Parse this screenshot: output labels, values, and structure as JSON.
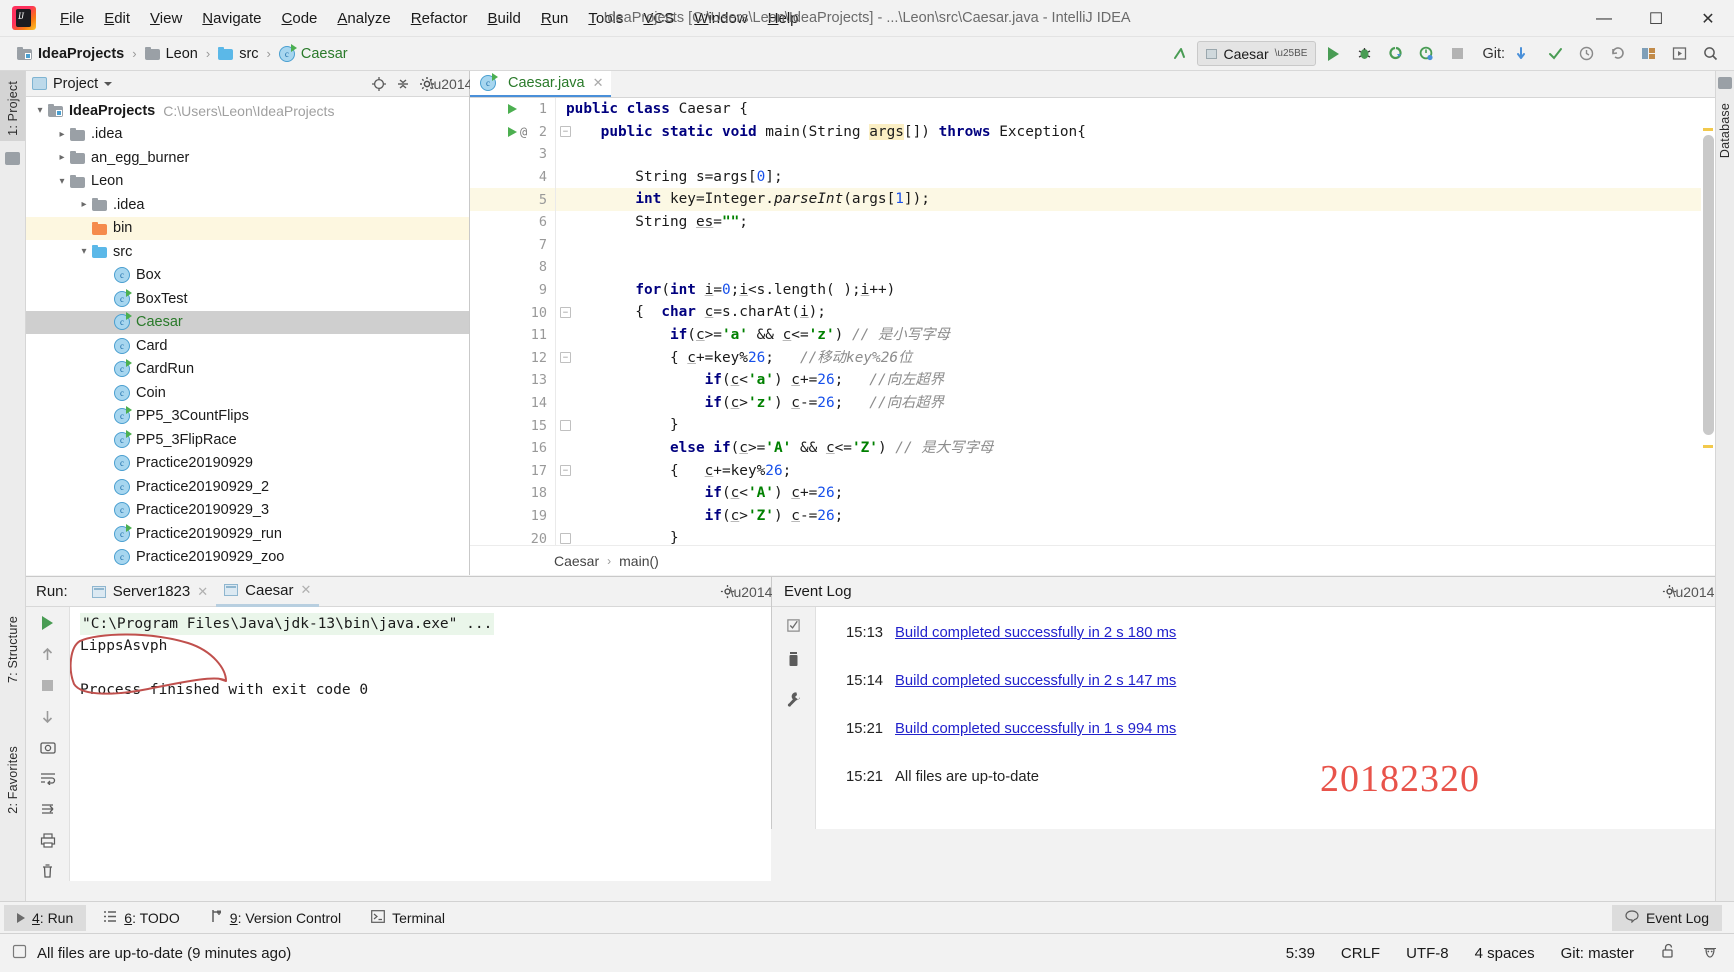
{
  "titlebar": {
    "menus": [
      {
        "first": "F",
        "rest": "ile"
      },
      {
        "first": "E",
        "rest": "dit"
      },
      {
        "first": "V",
        "rest": "iew"
      },
      {
        "first": "N",
        "rest": "avigate"
      },
      {
        "first": "C",
        "rest": "ode"
      },
      {
        "first": "A",
        "rest": "nalyze"
      },
      {
        "first": "R",
        "rest": "efactor"
      },
      {
        "first": "B",
        "rest": "uild"
      },
      {
        "first": "R",
        "rest": "un"
      },
      {
        "first": "T",
        "rest": "ools"
      },
      {
        "first": "V",
        "rest": "CS"
      },
      {
        "first": "W",
        "rest": "indow"
      },
      {
        "first": "H",
        "rest": "elp"
      }
    ],
    "window_title": "IdeaProjects [C:\\Users\\Leon\\IdeaProjects] - ...\\Leon\\src\\Caesar.java - IntelliJ IDEA",
    "minimize": "—",
    "maximize": "☐",
    "close": "✕"
  },
  "navbar": {
    "breadcrumbs": [
      {
        "label": "IdeaProjects",
        "icon": "project-folder-icon",
        "style": "bold"
      },
      {
        "label": "Leon",
        "icon": "folder-grey-icon",
        "style": "normal"
      },
      {
        "label": "src",
        "icon": "folder-blue-icon",
        "style": "normal"
      },
      {
        "label": "Caesar",
        "icon": "java-class-runnable-icon",
        "style": "green"
      }
    ],
    "separator": "›",
    "run_config": "Caesar",
    "git_label": "Git:",
    "buttons": {
      "back": "↖",
      "run": "run-button",
      "debug": "debug-button",
      "run_coverage": "run-with-coverage-button",
      "profile": "profiler-button",
      "stop": "stop-button",
      "update_project": "update-project-button",
      "commit": "commit-button",
      "history": "history-button",
      "rollback": "rollback-button",
      "settings": "settings-button",
      "layout": "layout-button",
      "search": "search-button"
    }
  },
  "left_stripe": {
    "project_label": "1: Project",
    "structure_label": "7: Structure",
    "favorites_label": "2: Favorites"
  },
  "right_stripe": {
    "database_label": "Database"
  },
  "project_panel": {
    "title": "Project",
    "header_icons": [
      "locate-icon",
      "collapse-all-icon",
      "settings-gear-icon",
      "hide-icon"
    ],
    "tree": [
      {
        "indent": 0,
        "arrow": "∨",
        "icon": "project-folder-icon",
        "label": "IdeaProjects",
        "style": "bold",
        "path": "C:\\Users\\Leon\\IdeaProjects",
        "state": "normal"
      },
      {
        "indent": 1,
        "arrow": "›",
        "icon": "folder-grey-icon",
        "label": ".idea",
        "style": "normal",
        "path": "",
        "state": "normal"
      },
      {
        "indent": 1,
        "arrow": "›",
        "icon": "folder-grey-icon",
        "label": "an_egg_burner",
        "style": "normal",
        "path": "",
        "state": "normal"
      },
      {
        "indent": 1,
        "arrow": "∨",
        "icon": "folder-grey-icon",
        "label": "Leon",
        "style": "normal",
        "path": "",
        "state": "normal"
      },
      {
        "indent": 2,
        "arrow": "›",
        "icon": "folder-grey-icon",
        "label": ".idea",
        "style": "normal",
        "path": "",
        "state": "normal"
      },
      {
        "indent": 2,
        "arrow": "",
        "icon": "folder-orange-icon",
        "label": "bin",
        "style": "normal",
        "path": "",
        "state": "highlight"
      },
      {
        "indent": 2,
        "arrow": "∨",
        "icon": "folder-blue-icon",
        "label": "src",
        "style": "normal",
        "path": "",
        "state": "normal"
      },
      {
        "indent": 3,
        "arrow": "",
        "icon": "java-class-icon",
        "label": "Box",
        "style": "normal",
        "path": "",
        "state": "normal"
      },
      {
        "indent": 3,
        "arrow": "",
        "icon": "java-class-runnable-icon",
        "label": "BoxTest",
        "style": "normal",
        "path": "",
        "state": "normal"
      },
      {
        "indent": 3,
        "arrow": "",
        "icon": "java-class-runnable-icon",
        "label": "Caesar",
        "style": "green",
        "path": "",
        "state": "selected"
      },
      {
        "indent": 3,
        "arrow": "",
        "icon": "java-class-icon",
        "label": "Card",
        "style": "normal",
        "path": "",
        "state": "normal"
      },
      {
        "indent": 3,
        "arrow": "",
        "icon": "java-class-runnable-icon",
        "label": "CardRun",
        "style": "normal",
        "path": "",
        "state": "normal"
      },
      {
        "indent": 3,
        "arrow": "",
        "icon": "java-class-icon",
        "label": "Coin",
        "style": "normal",
        "path": "",
        "state": "normal"
      },
      {
        "indent": 3,
        "arrow": "",
        "icon": "java-class-runnable-icon",
        "label": "PP5_3CountFlips",
        "style": "normal",
        "path": "",
        "state": "normal"
      },
      {
        "indent": 3,
        "arrow": "",
        "icon": "java-class-runnable-icon",
        "label": "PP5_3FlipRace",
        "style": "normal",
        "path": "",
        "state": "normal"
      },
      {
        "indent": 3,
        "arrow": "",
        "icon": "java-class-icon",
        "label": "Practice20190929",
        "style": "normal",
        "path": "",
        "state": "normal"
      },
      {
        "indent": 3,
        "arrow": "",
        "icon": "java-class-icon",
        "label": "Practice20190929_2",
        "style": "normal",
        "path": "",
        "state": "normal"
      },
      {
        "indent": 3,
        "arrow": "",
        "icon": "java-class-icon",
        "label": "Practice20190929_3",
        "style": "normal",
        "path": "",
        "state": "normal"
      },
      {
        "indent": 3,
        "arrow": "",
        "icon": "java-class-runnable-icon",
        "label": "Practice20190929_run",
        "style": "normal",
        "path": "",
        "state": "normal"
      },
      {
        "indent": 3,
        "arrow": "",
        "icon": "java-class-icon",
        "label": "Practice20190929_zoo",
        "style": "normal",
        "path": "",
        "state": "normal"
      }
    ]
  },
  "editor": {
    "tab": {
      "label": "Caesar.java",
      "icon": "java-class-runnable-icon",
      "close": "✕"
    },
    "breadcrumb": [
      "Caesar",
      "main()"
    ],
    "breadcrumb_sep": "›",
    "lines": [
      {
        "n": "1",
        "gutter": "run",
        "fold": "",
        "hl": false
      },
      {
        "n": "2",
        "gutter": "run-at",
        "fold": "open",
        "hl": false
      },
      {
        "n": "3",
        "gutter": "",
        "fold": "",
        "hl": false
      },
      {
        "n": "4",
        "gutter": "",
        "fold": "",
        "hl": false
      },
      {
        "n": "5",
        "gutter": "",
        "fold": "",
        "hl": true
      },
      {
        "n": "6",
        "gutter": "",
        "fold": "",
        "hl": false
      },
      {
        "n": "7",
        "gutter": "",
        "fold": "",
        "hl": false
      },
      {
        "n": "8",
        "gutter": "",
        "fold": "",
        "hl": false
      },
      {
        "n": "9",
        "gutter": "",
        "fold": "",
        "hl": false
      },
      {
        "n": "10",
        "gutter": "",
        "fold": "open",
        "hl": false
      },
      {
        "n": "11",
        "gutter": "",
        "fold": "",
        "hl": false
      },
      {
        "n": "12",
        "gutter": "",
        "fold": "open",
        "hl": false
      },
      {
        "n": "13",
        "gutter": "",
        "fold": "",
        "hl": false
      },
      {
        "n": "14",
        "gutter": "",
        "fold": "",
        "hl": false
      },
      {
        "n": "15",
        "gutter": "",
        "fold": "close",
        "hl": false
      },
      {
        "n": "16",
        "gutter": "",
        "fold": "",
        "hl": false
      },
      {
        "n": "17",
        "gutter": "",
        "fold": "open",
        "hl": false
      },
      {
        "n": "18",
        "gutter": "",
        "fold": "",
        "hl": false
      },
      {
        "n": "19",
        "gutter": "",
        "fold": "",
        "hl": false
      },
      {
        "n": "20",
        "gutter": "",
        "fold": "close",
        "hl": false
      }
    ],
    "code_text": [
      "public class Caesar {",
      "    public static void main(String args[]) throws Exception{",
      "",
      "        String s=args[0];",
      "        int key=Integer.parseInt(args[1]);",
      "        String es=\"\";",
      "",
      "",
      "        for(int i=0;i<s.length( );i++)",
      "        {  char c=s.charAt(i);",
      "            if(c>='a' && c<='z') // 是小写字母",
      "            { c+=key%26;   //移动key%26位",
      "                if(c<'a') c+=26;   //向左超界",
      "                if(c>'z') c-=26;   //向右超界",
      "            }",
      "            else if(c>='A' && c<='Z') // 是大写字母",
      "            {   c+=key%26;",
      "                if(c<'A') c+=26;",
      "                if(c>'Z') c-=26;",
      "            }"
    ]
  },
  "run_panel": {
    "label": "Run:",
    "tabs": [
      {
        "label": "Server1823",
        "active": false,
        "close": "✕"
      },
      {
        "label": "Caesar",
        "active": true,
        "close": "✕"
      }
    ],
    "side_buttons": [
      "rerun-icon",
      "up-arrow-icon",
      "down-arrow-icon",
      "camera-icon",
      "wrap-icon",
      "print-icon",
      "scroll-icon",
      "trash-icon"
    ],
    "console": {
      "command": "\"C:\\Program Files\\Java\\jdk-13\\bin\\java.exe\" ...",
      "output": "LippsAsvph",
      "exit": "Process finished with exit code 0"
    }
  },
  "event_log": {
    "title": "Event Log",
    "side_buttons": [
      "mark-read-icon",
      "trash-icon",
      "wrench-icon"
    ],
    "entries": [
      {
        "time": "15:13",
        "text": "Build completed successfully in 2 s 180 ms",
        "link": true
      },
      {
        "time": "15:14",
        "text": "Build completed successfully in 2 s 147 ms",
        "link": true
      },
      {
        "time": "15:21",
        "text": "Build completed successfully in 1 s 994 ms",
        "link": true
      },
      {
        "time": "15:21",
        "text": "All files are up-to-date",
        "link": false
      }
    ],
    "watermark": "20182320"
  },
  "toolwindow_bar": {
    "items": [
      {
        "icon": "run-triangle-icon",
        "num": "4",
        "label": ": Run",
        "active": true
      },
      {
        "icon": "todo-list-icon",
        "num": "6",
        "label": ": TODO",
        "active": false
      },
      {
        "icon": "version-control-icon",
        "num": "9",
        "label": ": Version Control",
        "active": false
      },
      {
        "icon": "terminal-icon",
        "num": "",
        "label": "Terminal",
        "active": false
      }
    ],
    "right_item": {
      "icon": "event-log-icon",
      "label": "Event Log"
    }
  },
  "statusbar": {
    "message": "All files are up-to-date (9 minutes ago)",
    "caret": "5:39",
    "line_sep": "CRLF",
    "encoding": "UTF-8",
    "indent": "4 spaces",
    "branch": "Git: master",
    "lock_icon": "unlocked-icon",
    "inspector_icon": "inspector-icon"
  },
  "colors": {
    "accent_blue": "#4a90d9",
    "green_run": "#499c54",
    "link_blue": "#2222cc",
    "annotation_red": "#c0504d",
    "watermark_red": "#e8534a"
  }
}
